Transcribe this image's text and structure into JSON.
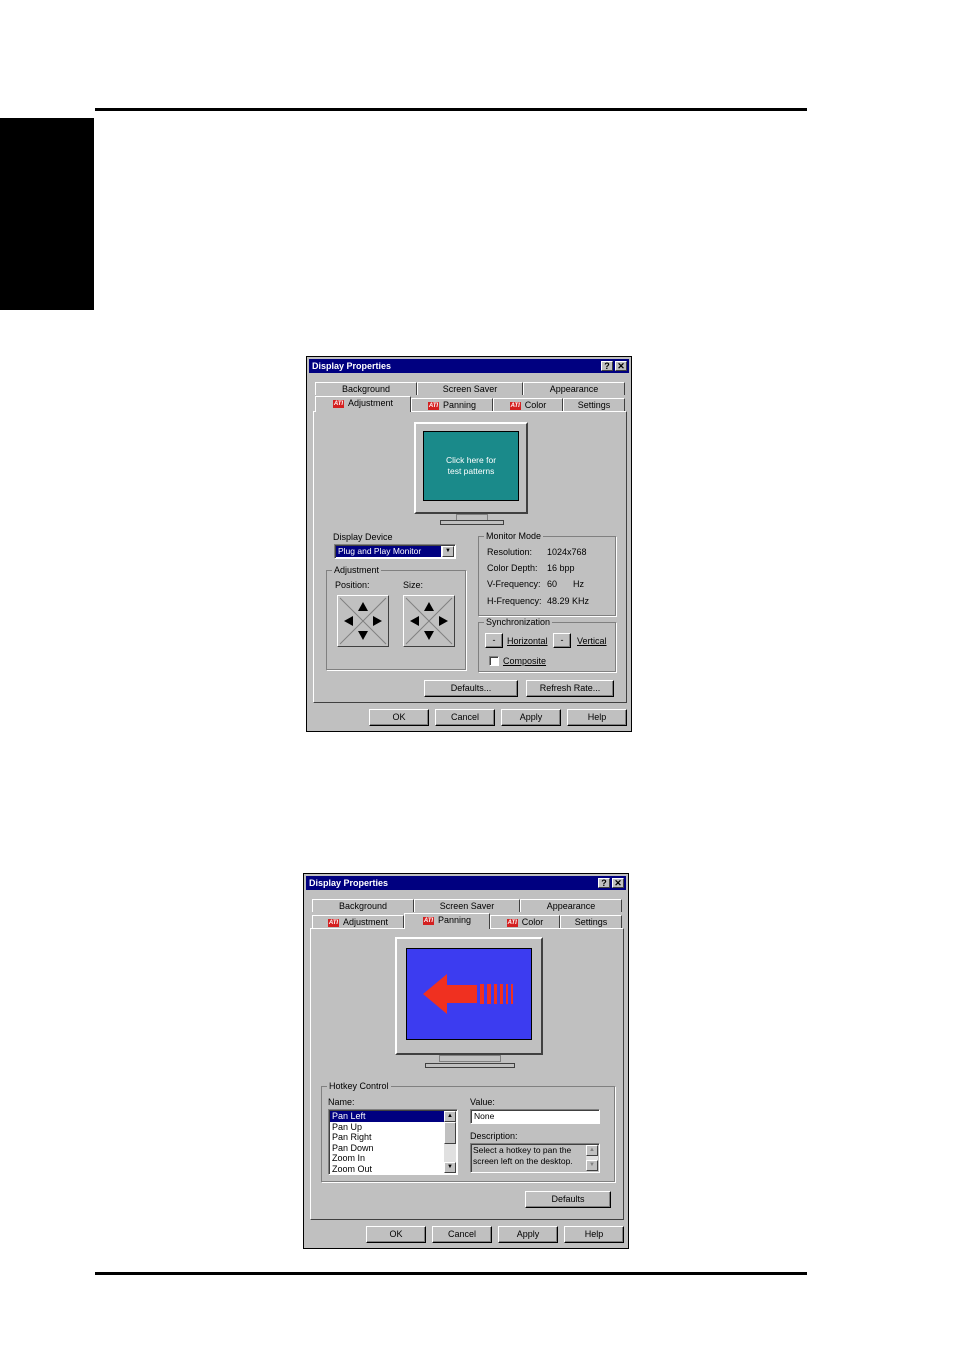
{
  "dialog1": {
    "title": "Display Properties",
    "help_glyph": "?",
    "close_glyph": "✕",
    "tabs_back": [
      "Background",
      "Screen Saver",
      "Appearance"
    ],
    "tabs_front": [
      "Adjustment",
      "Panning",
      "Color",
      "Settings"
    ],
    "monitor_text": "Click here for\ntest patterns",
    "display_device_label": "Display Device",
    "display_device_value": "Plug and Play Monitor",
    "adjustment_label": "Adjustment",
    "position_label": "Position:",
    "size_label": "Size:",
    "monitor_mode_label": "Monitor Mode",
    "mode_rows": [
      {
        "label": "Resolution:",
        "value": "1024x768",
        "unit": ""
      },
      {
        "label": "Color Depth:",
        "value": "16 bpp",
        "unit": ""
      },
      {
        "label": "V-Frequency:",
        "value": "60",
        "unit": "Hz"
      },
      {
        "label": "H-Frequency:",
        "value": "48.29 KHz",
        "unit": ""
      }
    ],
    "sync_label": "Synchronization",
    "sync_minus": "-",
    "horizontal_label": "Horizontal",
    "vertical_label": "Vertical",
    "composite_label": "Composite",
    "defaults_button": "Defaults...",
    "refresh_button": "Refresh Rate...",
    "ok": "OK",
    "cancel": "Cancel",
    "apply": "Apply",
    "help": "Help",
    "monitor_color": "#1a8a8a"
  },
  "dialog2": {
    "title": "Display Properties",
    "help_glyph": "?",
    "close_glyph": "✕",
    "tabs_back": [
      "Background",
      "Screen Saver",
      "Appearance"
    ],
    "tabs_front": [
      "Adjustment",
      "Panning",
      "Color",
      "Settings"
    ],
    "hotkey_label": "Hotkey Control",
    "name_label": "Name:",
    "names": [
      "Pan Left",
      "Pan Up",
      "Pan Right",
      "Pan Down",
      "Zoom In",
      "Zoom Out"
    ],
    "value_label": "Value:",
    "value": "None",
    "description_label": "Description:",
    "description": "Select a hotkey to pan the screen left on the desktop.",
    "defaults_button": "Defaults",
    "ok": "OK",
    "cancel": "Cancel",
    "apply": "Apply",
    "help": "Help",
    "screen_color": "#3c3cf0",
    "arrow_color": "#f03020"
  }
}
